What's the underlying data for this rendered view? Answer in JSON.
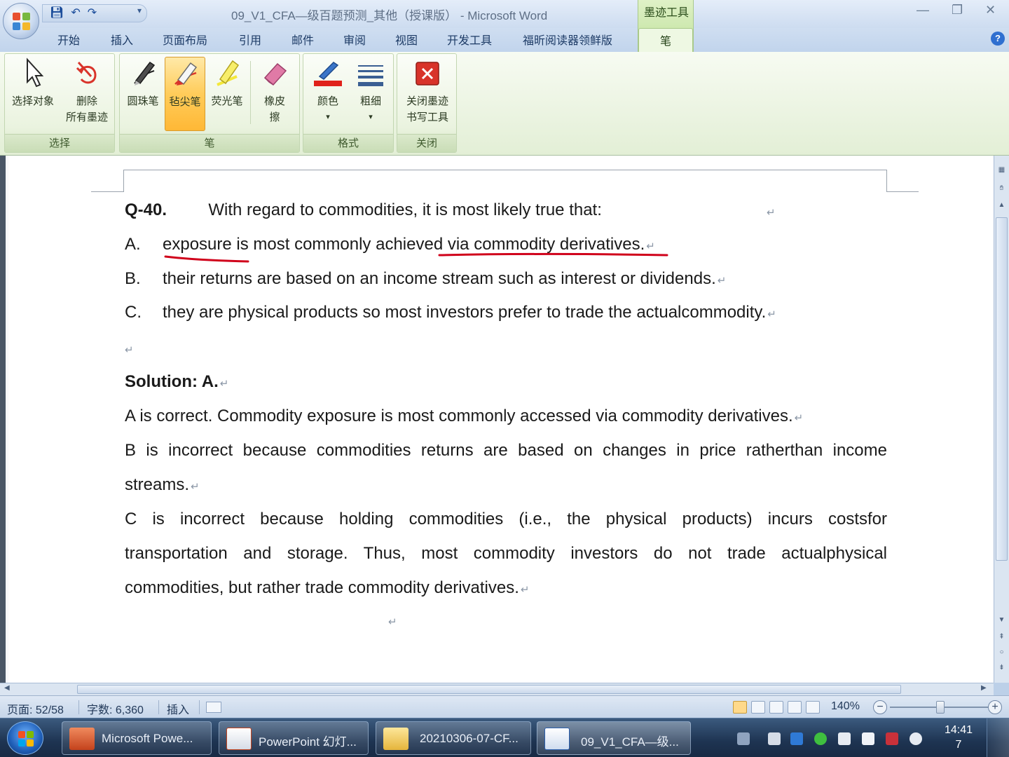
{
  "window": {
    "title": "09_V1_CFA—级百题预测_其他（授课版） - Microsoft Word",
    "contextual_tab_group": "墨迹工具",
    "controls": {
      "minimize": "—",
      "restore": "❐",
      "close": "✕"
    }
  },
  "quick_access": {
    "save_icon": "save-icon",
    "undo_icon": "undo-icon",
    "redo_icon": "redo-icon",
    "more": "▾"
  },
  "ribbon_tabs": [
    "开始",
    "插入",
    "页面布局",
    "引用",
    "邮件",
    "审阅",
    "视图",
    "开发工具",
    "福昕阅读器领鲜版",
    "笔"
  ],
  "active_tab": "笔",
  "ribbon": {
    "groups": {
      "select": {
        "label": "选择",
        "buttons": [
          {
            "label": "选择对象",
            "icon": "cursor-arrow-icon"
          },
          {
            "label_line1": "删除",
            "label_line2": "所有墨迹",
            "icon": "delete-ink-icon"
          }
        ]
      },
      "pen": {
        "label": "笔",
        "buttons": [
          {
            "label": "圆珠笔",
            "icon": "ballpoint-pen-icon"
          },
          {
            "label": "毡尖笔",
            "icon": "felt-tip-pen-icon",
            "selected": true
          },
          {
            "label": "荧光笔",
            "icon": "highlighter-icon"
          },
          {
            "label_line1": "橡皮",
            "label_line2": "擦",
            "icon": "eraser-icon"
          }
        ]
      },
      "format": {
        "label": "格式",
        "buttons": [
          {
            "label": "颜色",
            "icon": "ink-color-icon",
            "dropdown": "▾"
          },
          {
            "label": "粗细",
            "icon": "line-weight-icon",
            "dropdown": "▾"
          }
        ]
      },
      "close": {
        "label": "关闭",
        "buttons": [
          {
            "label_line1": "关闭墨迹",
            "label_line2": "书写工具",
            "icon": "close-red-x-icon"
          }
        ]
      }
    }
  },
  "document": {
    "paragraph_mark": "↵",
    "question": {
      "number": "Q-40.",
      "stem": "With regard to commodities, it is most likely true that:",
      "options": [
        {
          "letter": "A.",
          "text": "exposure is most commonly achieved via commodity derivatives."
        },
        {
          "letter": "B.",
          "text": "their returns are based on an income stream such as interest or dividends."
        },
        {
          "letter": "C.",
          "text": "they are physical products so most investors prefer to trade the actualcommodity."
        }
      ]
    },
    "solution": {
      "heading": "Solution: A.",
      "line1": "A is correct. Commodity exposure is most commonly accessed via commodity derivatives.",
      "b_line1": "B is incorrect because commodities returns are based on changes in price ratherthan income",
      "b_line2": "streams.",
      "c_line1": "C is incorrect because holding commodities (i.e., the physical products) incurs costsfor",
      "c_line2": "transportation and storage. Thus, most commodity investors do not trade actualphysical",
      "c_line3": "commodities, but rather trade commodity derivatives."
    },
    "ink_color": "#d0021b"
  },
  "statusbar": {
    "page": "页面: 52/58",
    "words": "字数: 6,360",
    "mode": "插入",
    "zoom": "140%",
    "zoom_minus": "−",
    "zoom_plus": "+"
  },
  "taskbar": {
    "items": [
      {
        "label": "Microsoft Powe...",
        "icon": "powerpoint-icon"
      },
      {
        "label": "PowerPoint 幻灯...",
        "icon": "slideshow-icon"
      },
      {
        "label": "20210306-07-CF...",
        "icon": "folder-icon"
      },
      {
        "label": "09_V1_CFA—级...",
        "icon": "word-doc-icon",
        "active": true
      }
    ],
    "clock_time": "14:41",
    "clock_day": "7"
  }
}
